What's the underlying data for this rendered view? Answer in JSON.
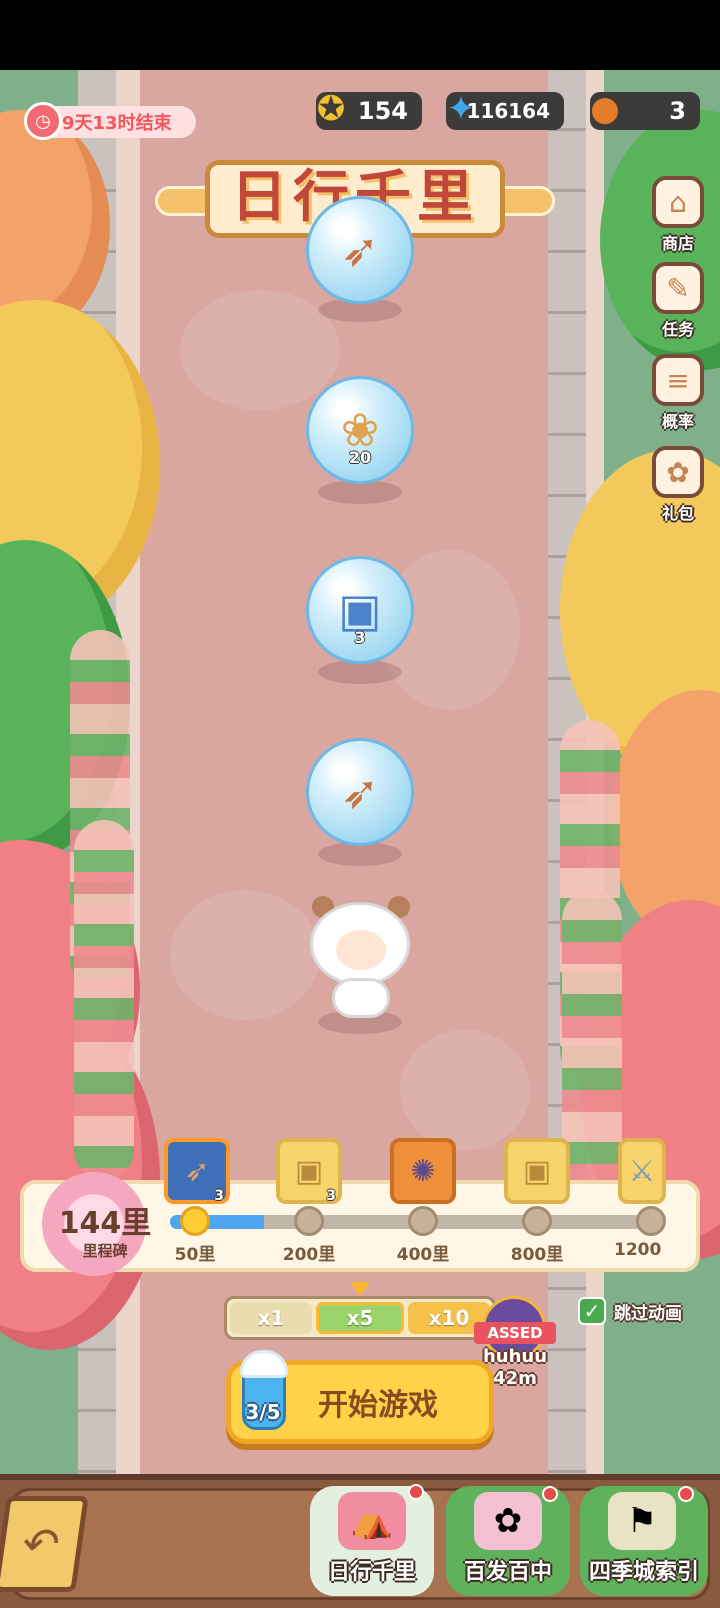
{
  "event": {
    "timer_text": "9天13时结束"
  },
  "resources": [
    {
      "name": "gold-medal",
      "value": "154",
      "icon": "medal-icon"
    },
    {
      "name": "blue-star",
      "value": "116164",
      "icon": "star-icon"
    },
    {
      "name": "burger",
      "value": "3",
      "icon": "burger-icon"
    }
  ],
  "title": "日行千里",
  "side_menu": [
    {
      "label": "商店",
      "icon": "shop-icon"
    },
    {
      "label": "任务",
      "icon": "task-icon"
    },
    {
      "label": "概率",
      "icon": "probability-icon"
    },
    {
      "label": "礼包",
      "icon": "gift-icon"
    }
  ],
  "road_items": [
    {
      "name": "spear",
      "count": ""
    },
    {
      "name": "cookies",
      "count": "20"
    },
    {
      "name": "chest",
      "count": "3"
    },
    {
      "name": "spear",
      "count": ""
    }
  ],
  "milestone": {
    "current_value": "144里",
    "label": "里程碑",
    "progress_fraction": 0.19,
    "nodes": [
      {
        "distance": "50里",
        "done": true,
        "reward_count": "3"
      },
      {
        "distance": "200里",
        "done": false,
        "reward_count": "3"
      },
      {
        "distance": "400里",
        "done": false,
        "reward_count": ""
      },
      {
        "distance": "800里",
        "done": false,
        "reward_count": ""
      },
      {
        "distance": "1200",
        "done": false,
        "reward_count": ""
      }
    ]
  },
  "multiplier": {
    "options": [
      "x1",
      "x5",
      "x10"
    ],
    "selected": "x5"
  },
  "skip_animation": {
    "label": "跳过动画",
    "checked": true
  },
  "passed": {
    "tag": "ASSED",
    "name": "huhuu",
    "distance": "42m"
  },
  "start": {
    "label": "开始游戏",
    "tickets": "3/5"
  },
  "bottom_nav": [
    {
      "label": "日行千里"
    },
    {
      "label": "百发百中"
    },
    {
      "label": "四季城索引"
    }
  ]
}
